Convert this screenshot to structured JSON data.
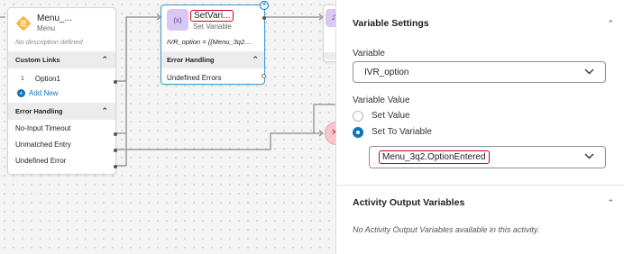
{
  "menu_node": {
    "title": "Menu_...",
    "subtitle": "Menu",
    "description": "No description defined",
    "custom_links_header": "Custom Links",
    "option_index": "1",
    "option_label": "Option1",
    "add_new": "Add New",
    "error_header": "Error Handling",
    "errors": [
      "No-Input Timeout",
      "Unmatched Entry",
      "Undefined Error"
    ]
  },
  "setvar_node": {
    "icon_text": "(x)",
    "title": "SetVari...",
    "subtitle": "Set Variable",
    "expression": "IVR_option = {{Menu_3q2....",
    "error_header": "Error Handling",
    "error_row": "Undefined Errors"
  },
  "panel": {
    "variable_settings_title": "Variable Settings",
    "variable_label": "Variable",
    "variable_value": "IVR_option",
    "variable_value_label": "Variable Value",
    "radio_set_value": "Set Value",
    "radio_set_to_variable": "Set To Variable",
    "set_to_variable_value": "Menu_3q2.OptionEntered",
    "activity_output_title": "Activity Output Variables",
    "activity_output_empty": "No Activity Output Variables available in this activity."
  },
  "colors": {
    "accent_blue": "#0b75b8",
    "highlight_red": "#d0021b",
    "menu_icon": "#f5b942",
    "setvar_icon": "#d9c8f5"
  }
}
